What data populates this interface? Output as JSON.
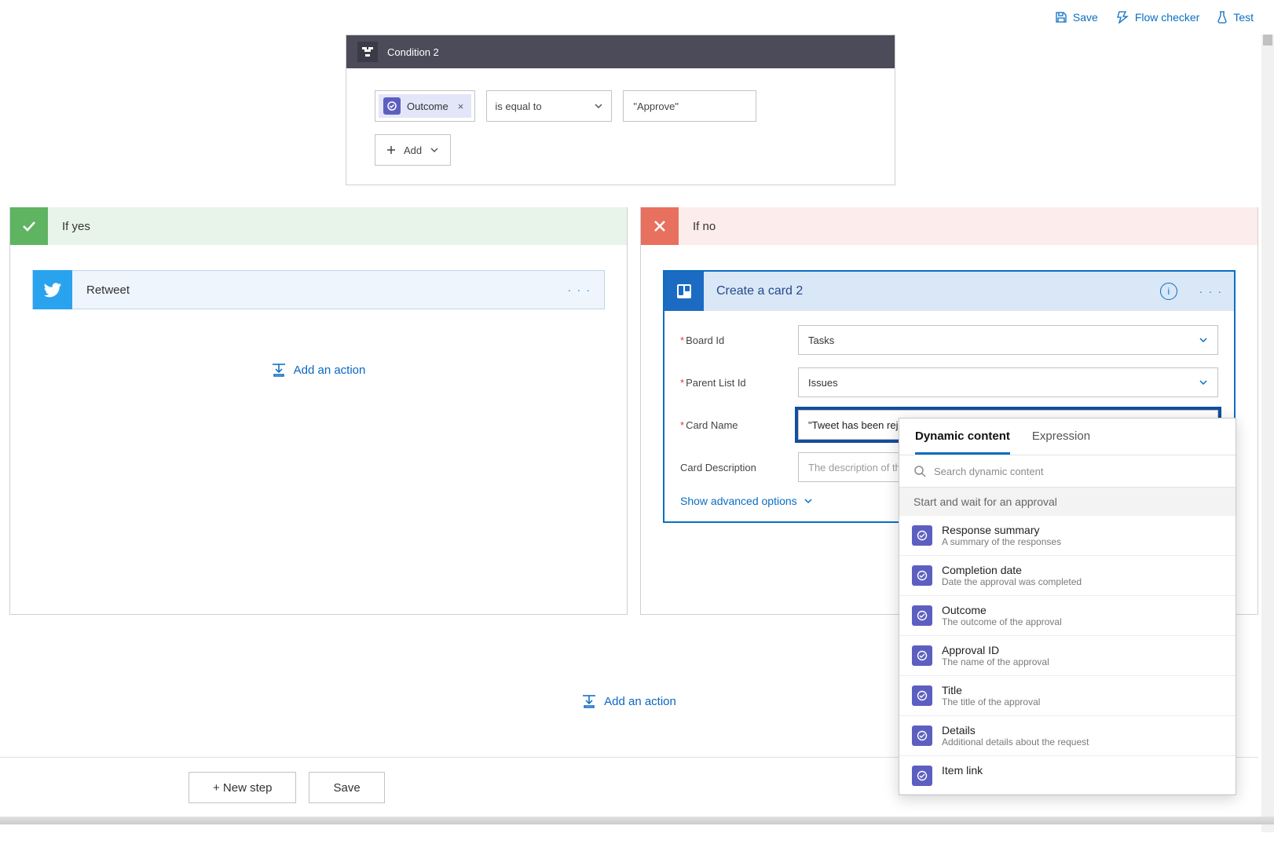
{
  "topbar": {
    "save": "Save",
    "flowChecker": "Flow checker",
    "test": "Test"
  },
  "condition": {
    "title": "Condition 2",
    "chip": "Outcome",
    "chipClose": "×",
    "operator": "is equal to",
    "value": "\"Approve\"",
    "addBtn": "Add"
  },
  "yes": {
    "label": "If yes",
    "action": {
      "title": "Retweet",
      "menu": "· · ·"
    },
    "addAction": "Add an action"
  },
  "no": {
    "label": "If no",
    "card": {
      "title": "Create a card 2",
      "menu": "· · ·",
      "fields": {
        "boardLabel": "Board Id",
        "boardValue": "Tasks",
        "parentLabel": "Parent List Id",
        "parentValue": "Issues",
        "nameLabel": "Card Name",
        "nameValue": "\"Tweet has been rejected\"",
        "descLabel": "Card Description",
        "descPlaceholder": "The description of the"
      },
      "advanced": "Show advanced options"
    }
  },
  "dyn": {
    "tabs": {
      "dc": "Dynamic content",
      "exp": "Expression"
    },
    "searchPlaceholder": "Search dynamic content",
    "group": "Start and wait for an approval",
    "items": [
      {
        "t": "Response summary",
        "s": "A summary of the responses"
      },
      {
        "t": "Completion date",
        "s": "Date the approval was completed"
      },
      {
        "t": "Outcome",
        "s": "The outcome of the approval"
      },
      {
        "t": "Approval ID",
        "s": "The name of the approval"
      },
      {
        "t": "Title",
        "s": "The title of the approval"
      },
      {
        "t": "Details",
        "s": "Additional details about the request"
      },
      {
        "t": "Item link",
        "s": ""
      }
    ]
  },
  "bottomAdd": "Add an action",
  "footer": {
    "newStep": "+ New step",
    "save": "Save"
  }
}
